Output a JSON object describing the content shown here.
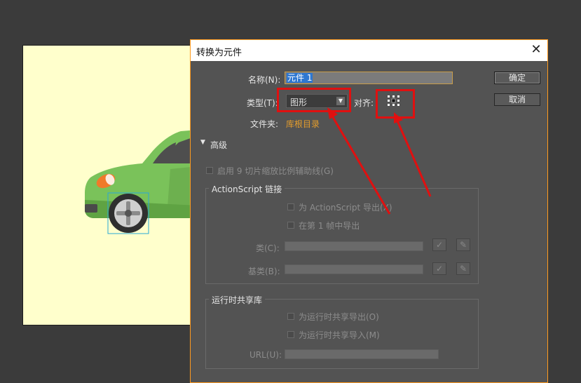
{
  "dialog": {
    "title": "转换为元件",
    "name_label": "名称(N):",
    "name_value": "元件 1",
    "type_label": "类型(T):",
    "type_value": "图形",
    "align_label": "对齐:",
    "folder_label": "文件夹:",
    "folder_value": "库根目录",
    "ok_label": "确定",
    "cancel_label": "取消",
    "advanced_label": "高级",
    "enable_guides_label": "启用 9 切片缩放比例辅助线(G)",
    "as_linkage": {
      "title": "ActionScript 链接",
      "export_as_label": "为 ActionScript 导出(X)",
      "export_frame_label": "在第 1 帧中导出",
      "class_label": "类(C):",
      "base_class_label": "基类(B):"
    },
    "runtime_sharing": {
      "title": "运行时共享库",
      "export_label": "为运行时共享导出(O)",
      "import_label": "为运行时共享导入(M)",
      "url_label": "URL(U):"
    }
  },
  "colors": {
    "dialog_bg": "#535353",
    "accent_orange": "#ff9a1e",
    "highlight_red": "#e01010",
    "stage_bg": "#ffffcc",
    "car_green": "#7ac25a"
  }
}
